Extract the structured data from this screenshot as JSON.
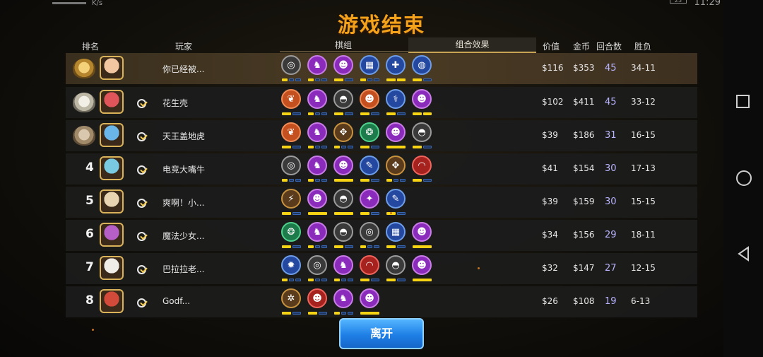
{
  "status": {
    "signal": "4G",
    "speed": "K/s",
    "battery": "23",
    "time": "11:29"
  },
  "title": "游戏结束",
  "headers": {
    "rank": "排名",
    "player": "玩家",
    "pieces": "棋组",
    "combo": "组合效果",
    "value": "价值",
    "gold": "金币",
    "rounds": "回合数",
    "record": "胜负"
  },
  "rows": [
    {
      "rank": "",
      "medal": "gold",
      "avatar_color": "#f2c6a0",
      "name": "你已经被...",
      "value": "$116",
      "gold": "$353",
      "rounds": "45",
      "record": "34-11",
      "synergies": [
        [
          "gray",
          "◎",
          1,
          3
        ],
        [
          "purple",
          "♞",
          1,
          3
        ],
        [
          "purple",
          "☻",
          1,
          2
        ],
        [
          "blue",
          "▦",
          1,
          3
        ],
        [
          "blue",
          "✚",
          2,
          2
        ],
        [
          "blue",
          "◍",
          1,
          2
        ]
      ]
    },
    {
      "rank": "",
      "medal": "silver",
      "avatar_color": "#e0555a",
      "name": "花生壳",
      "value": "$102",
      "gold": "$411",
      "rounds": "45",
      "record": "33-12",
      "synergies": [
        [
          "orange",
          "❦",
          1,
          2
        ],
        [
          "purple",
          "♞",
          1,
          3
        ],
        [
          "gray",
          "◓",
          1,
          2
        ],
        [
          "orange",
          "☻",
          1,
          2
        ],
        [
          "blue",
          "⚕",
          1,
          2
        ],
        [
          "purple",
          "☻",
          2,
          2
        ]
      ]
    },
    {
      "rank": "",
      "medal": "bronze",
      "avatar_color": "#6bb6e8",
      "name": "天王盖地虎",
      "value": "$39",
      "gold": "$186",
      "rounds": "31",
      "record": "16-15",
      "synergies": [
        [
          "orange",
          "❦",
          1,
          2
        ],
        [
          "purple",
          "♞",
          1,
          3
        ],
        [
          "bronze",
          "✥",
          1,
          3
        ],
        [
          "green",
          "❂",
          1,
          2
        ],
        [
          "purple",
          "☻",
          1,
          1
        ],
        [
          "gray",
          "◓",
          1,
          2
        ]
      ]
    },
    {
      "rank": "4",
      "medal": "",
      "avatar_color": "#79c9e0",
      "name": "电竞大嘴牛",
      "value": "$41",
      "gold": "$154",
      "rounds": "30",
      "record": "17-13",
      "synergies": [
        [
          "gray",
          "◎",
          1,
          3
        ],
        [
          "purple",
          "♞",
          1,
          3
        ],
        [
          "purple",
          "☻",
          1,
          1
        ],
        [
          "blue",
          "✎",
          1,
          2
        ],
        [
          "bronze",
          "✥",
          1,
          3
        ],
        [
          "red",
          "◠",
          1,
          2
        ]
      ]
    },
    {
      "rank": "5",
      "medal": "",
      "avatar_color": "#e8d4b0",
      "name": "爽啊！小...",
      "value": "$39",
      "gold": "$159",
      "rounds": "30",
      "record": "15-15",
      "synergies": [
        [
          "bronze",
          "⚡",
          1,
          2
        ],
        [
          "purple",
          "☻",
          1,
          1
        ],
        [
          "gray",
          "◓",
          1,
          1
        ],
        [
          "purple",
          "✦",
          1,
          2
        ],
        [
          "blue",
          "✎",
          1,
          2
        ]
      ]
    },
    {
      "rank": "6",
      "medal": "",
      "avatar_color": "#b55fc7",
      "name": "魔法少女...",
      "value": "$34",
      "gold": "$156",
      "rounds": "29",
      "record": "18-11",
      "synergies": [
        [
          "green",
          "❂",
          1,
          2
        ],
        [
          "purple",
          "♞",
          1,
          3
        ],
        [
          "gray",
          "◓",
          1,
          2
        ],
        [
          "gray",
          "◎",
          1,
          3
        ],
        [
          "blue",
          "▦",
          1,
          2
        ],
        [
          "purple",
          "☻",
          1,
          1
        ]
      ]
    },
    {
      "rank": "7",
      "medal": "",
      "avatar_color": "#f0ece6",
      "name": "巴拉拉老...",
      "value": "$32",
      "gold": "$147",
      "rounds": "27",
      "record": "12-15",
      "synergies": [
        [
          "blue",
          "✹",
          1,
          3
        ],
        [
          "gray",
          "◎",
          1,
          3
        ],
        [
          "purple",
          "♞",
          1,
          3
        ],
        [
          "red",
          "◠",
          1,
          2
        ],
        [
          "gray",
          "◓",
          1,
          2
        ],
        [
          "purple",
          "☻",
          1,
          1
        ]
      ]
    },
    {
      "rank": "8",
      "medal": "",
      "avatar_color": "#d24a3a",
      "name": "Godf...",
      "value": "$26",
      "gold": "$108",
      "rounds": "19",
      "record": "6-13",
      "synergies": [
        [
          "bronze",
          "✲",
          1,
          2
        ],
        [
          "red",
          "☻",
          1,
          2
        ],
        [
          "purple",
          "♞",
          1,
          3
        ],
        [
          "purple",
          "☻",
          1,
          1
        ]
      ]
    }
  ],
  "leave_button": "离开"
}
